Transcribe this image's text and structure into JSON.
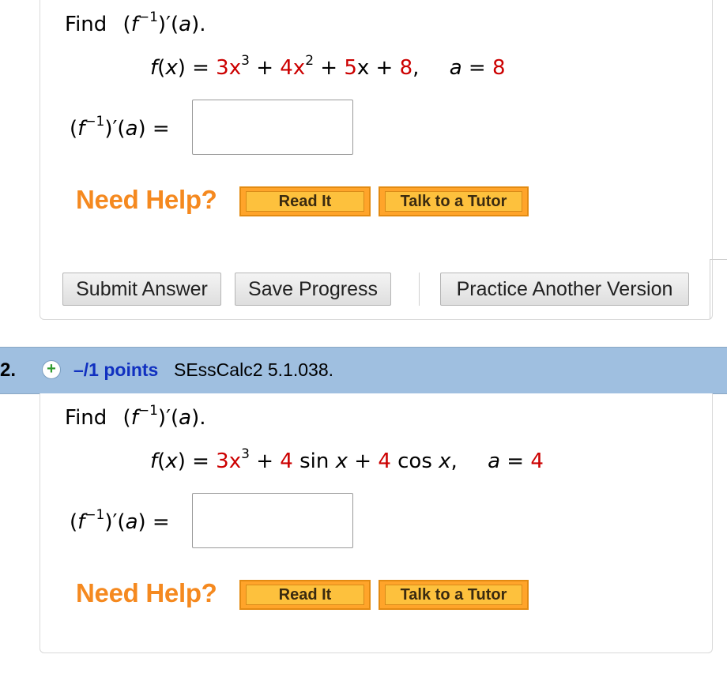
{
  "question1": {
    "find_label": "Find",
    "find_expr": "(f−1)′(a).",
    "formula": {
      "lhs": "f(x) = ",
      "parts": [
        {
          "text": "3x",
          "color": "red"
        },
        {
          "sup": "3"
        },
        {
          "text": " + "
        },
        {
          "text": "4x",
          "color": "red"
        },
        {
          "sup": "2"
        },
        {
          "text": " + "
        },
        {
          "text": "5",
          "color": "red"
        },
        {
          "text": "x + "
        },
        {
          "text": "8",
          "color": "red"
        },
        {
          "text": ","
        }
      ],
      "a_label": "a = ",
      "a_value": "8"
    },
    "answer_label": "(f−1)′(a) =",
    "answer_value": "",
    "need_help": "Need Help?",
    "read_it": "Read It",
    "talk_to_tutor": "Talk to a Tutor",
    "submit_answer": "Submit Answer",
    "save_progress": "Save Progress",
    "practice_another": "Practice Another Version"
  },
  "question2": {
    "number": "2.",
    "points": "–/1 points",
    "source": "SEssCalc2 5.1.038.",
    "find_label": "Find",
    "find_expr": "(f−1)′(a).",
    "formula": {
      "lhs": "f(x) = ",
      "a_label": "a = ",
      "a_value": "4"
    },
    "answer_label": "(f−1)′(a) =",
    "answer_value": "",
    "need_help": "Need Help?",
    "read_it": "Read It",
    "talk_to_tutor": "Talk to a Tutor"
  },
  "colors": {
    "accent_orange": "#f5891f",
    "header_blue": "#9fbfe0",
    "points_blue": "#1030c0",
    "value_red": "#cc0000",
    "plus_green": "#2f9a2f"
  },
  "icons": {
    "expand": "plus-icon"
  }
}
